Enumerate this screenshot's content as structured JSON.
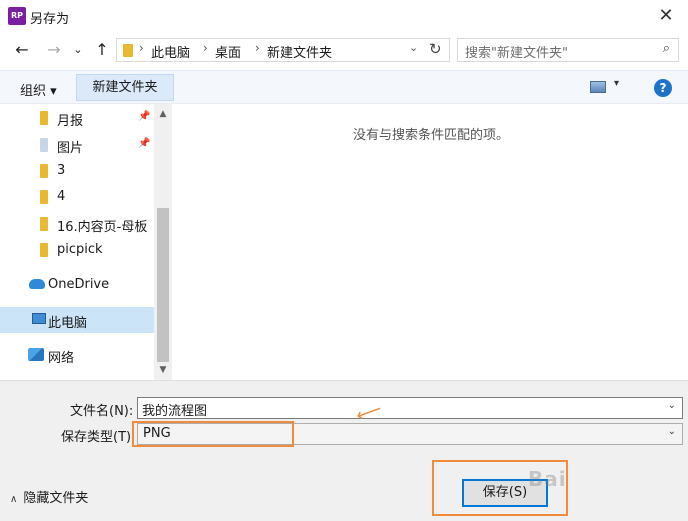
{
  "window": {
    "title": "另存为",
    "app_icon": "RP",
    "close": "✕"
  },
  "nav": {
    "back": "←",
    "forward": "→",
    "dropdown": "⌄",
    "up": "↑"
  },
  "address": {
    "crumbs": [
      "此电脑",
      "桌面",
      "新建文件夹"
    ],
    "sep": "›",
    "dropdown": "⌄",
    "refresh": "↻"
  },
  "search": {
    "placeholder": "搜索\"新建文件夹\"",
    "icon": "⌕"
  },
  "toolbar": {
    "organize": "组织 ▾",
    "new_folder": "新建文件夹",
    "view_drop": "▾",
    "help": "?"
  },
  "sidebar": {
    "items": [
      {
        "label": "月报",
        "icon": "folder-icon",
        "pinned": true
      },
      {
        "label": "图片",
        "icon": "pictures-folder-icon",
        "pinned": true
      },
      {
        "label": "3",
        "icon": "folder-icon"
      },
      {
        "label": "4",
        "icon": "folder-icon"
      },
      {
        "label": "16.内容页-母板",
        "icon": "folder-icon"
      },
      {
        "label": "picpick",
        "icon": "folder-icon"
      },
      {
        "label": "OneDrive",
        "icon": "onedrive-icon"
      },
      {
        "label": "此电脑",
        "icon": "computer-icon",
        "selected": true
      },
      {
        "label": "网络",
        "icon": "network-icon"
      }
    ],
    "pin": "📌",
    "scroll_up": "▲",
    "scroll_down": "▼"
  },
  "content": {
    "empty_message": "没有与搜索条件匹配的项。"
  },
  "form": {
    "filename_label": "文件名(N):",
    "filename_value": "我的流程图",
    "filetype_label": "保存类型(T)",
    "filetype_value": "PNG",
    "drop": "⌄",
    "arrow": "⟵"
  },
  "footer": {
    "hide_folders": "隐藏文件夹",
    "chevron": "∧",
    "save": "保存(S)",
    "watermark": "Bai"
  },
  "colors": {
    "accent": "#0078d7",
    "annotation": "#f08c3c",
    "selected": "#cce4f7",
    "folder": "#e8b830"
  }
}
